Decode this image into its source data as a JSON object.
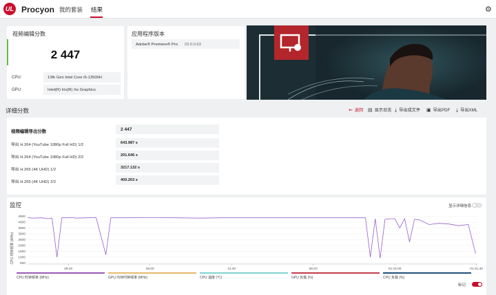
{
  "header": {
    "logo": "UL",
    "app_title": "Procyon",
    "tabs": [
      {
        "label": "我的套装"
      },
      {
        "label": "结果"
      }
    ]
  },
  "score_card": {
    "title": "视频编辑分数",
    "score": "2 447",
    "cpu_label": "CPU:",
    "cpu_value": "13th Gen Intel Core i5-13500H",
    "gpu_label": "GPU:",
    "gpu_value": "Intel(R) Iris(R) Xe Graphics"
  },
  "app_card": {
    "title": "应用程序版本",
    "app_name": "Adobe® Premiere® Pro",
    "app_version": "23.0.0.63"
  },
  "details": {
    "title": "详细分数",
    "actions": [
      {
        "label": "返回",
        "icon": "back-arrow-icon"
      },
      {
        "label": "显示日志",
        "icon": "document-icon"
      },
      {
        "label": "导出成文件",
        "icon": "download-icon"
      },
      {
        "label": "导出PDF",
        "icon": "printer-icon"
      },
      {
        "label": "导出XML",
        "icon": "download-icon"
      }
    ],
    "rows": [
      {
        "label": "视频编辑导出分数",
        "value": "2 447"
      },
      {
        "label": "导出 H.264 (YouTube 1080p Full HD) 1/2",
        "value": "643.987 s"
      },
      {
        "label": "导出 H.264 (YouTube 1080p Full HD) 2/2",
        "value": "201.646 s"
      },
      {
        "label": "导出 H.265 (4K UHD) 1/2",
        "value": "3217.132 s"
      },
      {
        "label": "导出 H.265 (4K UHD) 2/2",
        "value": "400.263 s"
      }
    ]
  },
  "monitor": {
    "title": "监控",
    "detail_toggle_label": "显示详细信息",
    "marker_toggle_label": "标记",
    "accent": "#c8102e",
    "line_color": "#9560c8",
    "y_axis_label": "CPU 时钟频率 (MHz)",
    "legend": [
      {
        "label": "CPU 时钟频率 (MHz)",
        "color": "#9b59b6"
      },
      {
        "label": "GPU 内存时钟频率 (MHz)",
        "color": "#e8b86b"
      },
      {
        "label": "CPU 温度 (°C)",
        "color": "#7fd3cf"
      },
      {
        "label": "GPU 负载 (%)",
        "color": "#c03a4a"
      },
      {
        "label": "CPU 负载 (%)",
        "color": "#1f4e79"
      }
    ]
  },
  "chart_data": {
    "type": "line",
    "ylabel": "CPU 时钟频率 (MHz)",
    "ylim": [
      400,
      4600
    ],
    "y_ticks": [
      "4500",
      "4000",
      "3500",
      "3000",
      "2500",
      "2000",
      "1500",
      "1000",
      "500"
    ],
    "x_ticks": [
      "08:20",
      "25:00",
      "41:40",
      "58:20",
      "01:15:00",
      "01:31:40"
    ],
    "grid": true,
    "series": [
      {
        "name": "CPU 时钟频率 (MHz)",
        "x": [
          0,
          1,
          3,
          4,
          5,
          6,
          7,
          8,
          9,
          10,
          12,
          14,
          16,
          17,
          18,
          20,
          25,
          30,
          35,
          40,
          45,
          50,
          55,
          60,
          65,
          69,
          70,
          71,
          72,
          73,
          74,
          75,
          76,
          77,
          78,
          79,
          80,
          82,
          84,
          86,
          88,
          90,
          91.5
        ],
        "y": [
          4400,
          4350,
          4380,
          4300,
          4350,
          1000,
          4380,
          4380,
          4400,
          4350,
          4380,
          4400,
          1200,
          4380,
          4380,
          4380,
          4400,
          4380,
          4350,
          4380,
          4380,
          4380,
          4380,
          4380,
          4380,
          4380,
          1000,
          4300,
          900,
          4250,
          4300,
          4300,
          3500,
          4300,
          2300,
          4250,
          4200,
          3800,
          3900,
          3850,
          3700,
          3800,
          1300
        ]
      }
    ]
  }
}
